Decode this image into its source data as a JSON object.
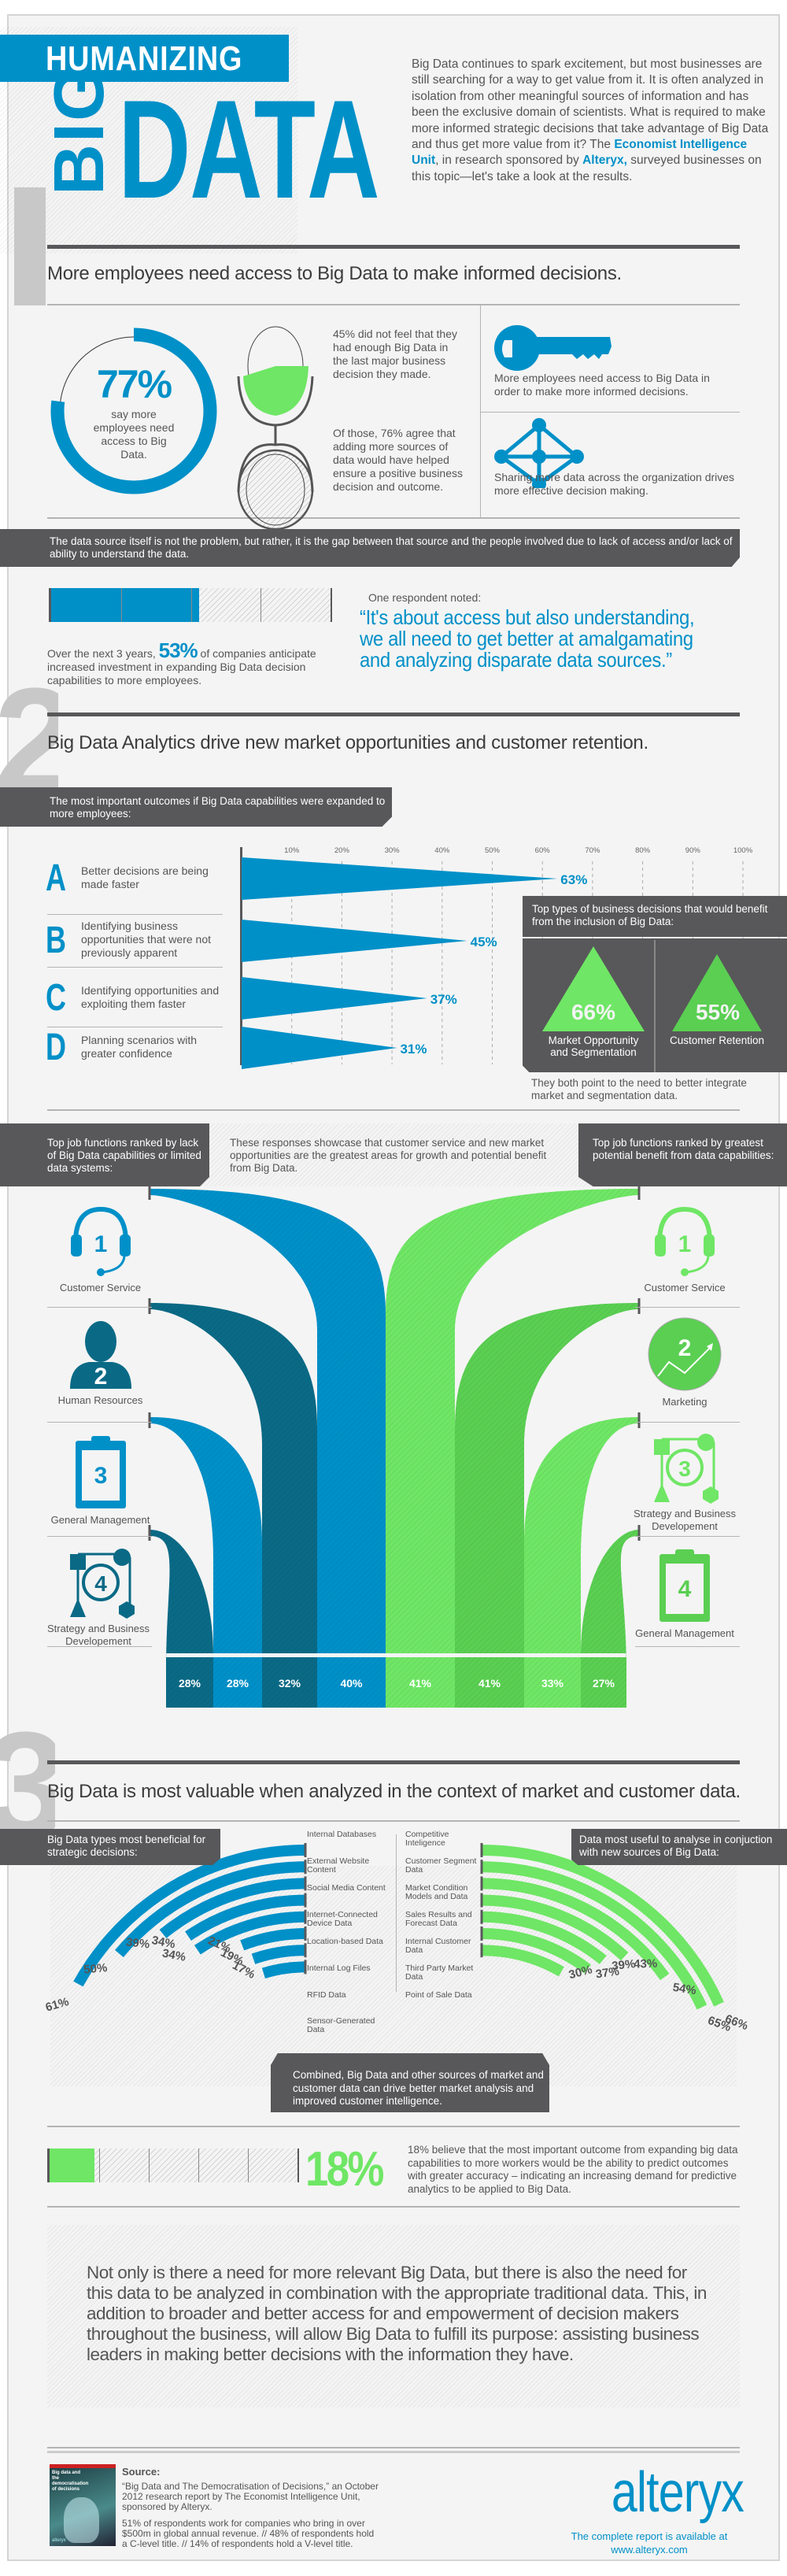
{
  "header": {
    "title_top": "HUMANIZING",
    "title_big": "BIG",
    "title_data": "DATA",
    "intro_1": "Big Data continues to spark excitement, but most businesses are still searching for a way to get value from it. It is often analyzed in isolation from other meaningful sources of information and has been the exclusive domain of scientists.  What is required to make more informed strategic decisions that take advantage of Big Data and thus get more value from it? The ",
    "intro_eiu": "Economist Intelligence Unit",
    "intro_2": ", in research sponsored by ",
    "intro_alteryx": "Alteryx,",
    "intro_3": " surveyed businesses on this topic—let's take a look at the results."
  },
  "section1": {
    "number": "1",
    "title": "More employees need access to Big Data to make informed decisions.",
    "stat_value": "77%",
    "stat_caption": "say more employees need access to Big Data.",
    "stat_fraction": 0.77,
    "fact_45": "45% did not feel that they had enough Big Data in the last major business decision they made.",
    "fact_76": "Of those, 76% agree that adding more sources of data would have helped ensure a positive business decision and outcome.",
    "key_text": "More employees need access to Big Data in order to make more informed decisions.",
    "network_text": "Sharing more data across the organization drives more effective decision making.",
    "banner": "The data source itself is not the problem, but rather, it is the gap between that source and the people involved due to lack of access and/or lack of ability to understand the data.",
    "investment_prefix": "Over the next 3 years, ",
    "investment_value": "53%",
    "investment_suffix": " of companies anticipate increased investment in expanding Big Data decision capabilities to more employees.",
    "investment_fraction": 0.53,
    "quote_lead": "One respondent noted:",
    "quote": "“It's about access but also understanding, we all need to get better at amalgamating and analyzing disparate data sources.”"
  },
  "section2": {
    "number": "2",
    "title": "Big Data Analytics drive new market opportunities and customer retention.",
    "outcomes_header": "The most important outcomes if Big Data capabilities were expanded to more employees:",
    "decisions_header": "Top types of business decisions that would benefit from the inclusion of Big Data:",
    "decisions": [
      {
        "value": "66%",
        "label": "Market Opportunity and Segmentation"
      },
      {
        "value": "55%",
        "label": "Customer Retention"
      }
    ],
    "decisions_note": "They both point to the need to better integrate market and segmentation data.",
    "left_header": "Top job functions ranked by lack of Big Data capabilities or limited data systems:",
    "center_note": "These responses showcase that customer service and new market opportunities are the greatest areas for growth and potential benefit from Big Data.",
    "right_header": "Top job functions ranked by greatest potential benefit from data capabilities:",
    "left_functions": [
      {
        "rank": "1",
        "label": "Customer Service",
        "icon": "headset-icon",
        "value": "40%"
      },
      {
        "rank": "2",
        "label": "Human Resources",
        "icon": "person-icon",
        "value": "32%"
      },
      {
        "rank": "3",
        "label": "General Management",
        "icon": "clipboard-icon",
        "value": "28%"
      },
      {
        "rank": "4",
        "label": "Strategy and Business Developement",
        "icon": "flowchart-icon",
        "value": "28%"
      }
    ],
    "right_functions": [
      {
        "rank": "1",
        "label": "Customer Service",
        "icon": "headset-icon",
        "value": "41%"
      },
      {
        "rank": "2",
        "label": "Marketing",
        "icon": "growth-chart-icon",
        "value": "41%"
      },
      {
        "rank": "3",
        "label": "Strategy and Business Developement",
        "icon": "flowchart-icon",
        "value": "33%"
      },
      {
        "rank": "4",
        "label": "General Management",
        "icon": "clipboard-icon",
        "value": "27%"
      }
    ],
    "stream_values_left_to_right": [
      "28%",
      "28%",
      "32%",
      "40%",
      "41%",
      "41%",
      "33%",
      "27%"
    ]
  },
  "section3": {
    "number": "3",
    "title": "Big Data is most valuable when analyzed in the context of market and customer data.",
    "left_header": "Big Data types most beneficial for strategic decisions:",
    "right_header": "Data most useful to analyse in conjuction with new sources of Big Data:",
    "combined_note": "Combined, Big Data and other sources of market and customer data can drive better market analysis and improved customer intelligence.",
    "predict_value": "18%",
    "predict_fraction": 0.18,
    "predict_text": "18% believe that the most important outcome from expanding big data capabilities to more workers would be the ability to predict outcomes with greater accuracy – indicating an increasing demand for predictive analytics to be applied to Big Data.",
    "conclusion": "Not only is there a need for more relevant Big Data, but there is also the need for this data to be analyzed in combination with the appropriate traditional data. This, in addition to broader and better access for and empowerment of decision makers throughout the business, will allow Big Data to fulfill its purpose: assisting business leaders in making better decisions with the information they have."
  },
  "footer": {
    "source_label": "Source:",
    "source_text": "“Big Data and The Democratisation of Decisions,” an October 2012 research report by The Economist Intelligence Unit, sponsored by Alteryx.",
    "respondents": "51% of respondents work for companies who bring in over $500m in global annual revenue. // 48% of respondents hold a C-level title. // 14% of respondents hold a V-level title.",
    "cover_title": "Big data and the democratisation of decisions",
    "cover_brand": "alteryx",
    "logo": "alteryx",
    "cta_line1": "The complete report is available at",
    "cta_line2": "www.alteryx.com"
  },
  "colors": {
    "blue": "#0090c8",
    "dark_teal": "#0a6a86",
    "green": "#6fe665",
    "green_dark": "#5acf52",
    "dark_gray": "#58585a",
    "bg": "#f4f4f4"
  },
  "chart_data": [
    {
      "type": "bar",
      "title": "The most important outcomes if Big Data capabilities were expanded to more employees",
      "orientation": "horizontal",
      "categories": [
        "A: Better decisions are being made faster",
        "B: Identifying business opportunities that were not previously apparent",
        "C: Identifying opportunities and exploiting them faster",
        "D: Planning scenarios with greater confidence"
      ],
      "letters": [
        "A",
        "B",
        "C",
        "D"
      ],
      "labels": [
        "Better decisions are being made faster",
        "Identifying business opportunities that were not previously apparent",
        "Identifying opportunities and exploiting them faster",
        "Planning scenarios with greater confidence"
      ],
      "values": [
        63,
        45,
        37,
        31
      ],
      "value_labels": [
        "63%",
        "45%",
        "37%",
        "31%"
      ],
      "xlim": [
        0,
        100
      ],
      "xticks": [
        "10%",
        "20%",
        "30%",
        "40%",
        "50%",
        "60%",
        "70%",
        "80%",
        "90%",
        "100%"
      ],
      "grid": true
    },
    {
      "type": "bar",
      "title": "Big Data types most beneficial for strategic decisions",
      "categories": [
        "Internal Databases",
        "External Website Content",
        "Social Media Content",
        "Internet-Connected Device Data",
        "Location-based Data",
        "Internal Log Files",
        "RFID Data",
        "Sensor-Generated Data"
      ],
      "values": [
        61,
        50,
        39,
        34,
        34,
        21,
        19,
        17
      ],
      "value_labels": [
        "61%",
        "50%",
        "39%",
        "34%",
        "34%",
        "21%",
        "19%",
        "17%"
      ],
      "ylim": [
        0,
        100
      ]
    },
    {
      "type": "bar",
      "title": "Data most useful to analyse in conjuction with new sources of Big Data",
      "categories": [
        "Competitive Inteligence",
        "Customer Segment Data",
        "Market Condition Models and Data",
        "Sales Results and Forecast Data",
        "Internal Customer Data",
        "Third Party Market Data",
        "Point of Sale Data"
      ],
      "values": [
        66,
        65,
        54,
        43,
        39,
        37,
        30
      ],
      "value_labels": [
        "66%",
        "65%",
        "54%",
        "43%",
        "39%",
        "37%",
        "30%"
      ],
      "ylim": [
        0,
        100
      ]
    }
  ]
}
